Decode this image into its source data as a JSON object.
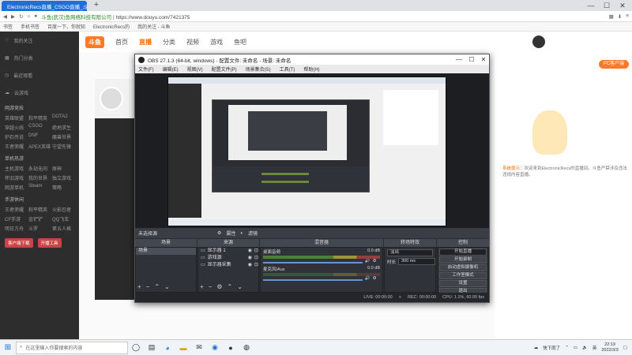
{
  "browser": {
    "tab_title": "ElectronicRecs直播_CSGO直播_斗",
    "new_tab": "+",
    "url_secure": "斗鱼(武汉)鱼网络科技有限公司 |",
    "url": "https://www.douyu.com/7421375",
    "bookmarks": [
      "书签",
      "手机书签",
      "百度一下，你就知",
      "ElectronicRecs的",
      "我的关注 - 斗鱼"
    ],
    "window_controls": [
      "—",
      "☐",
      "✕"
    ]
  },
  "site": {
    "logo": "斗鱼",
    "nav": [
      "首页",
      "直播",
      "分类",
      "视频",
      "游戏",
      "鱼吧"
    ],
    "nav_active": "直播",
    "pc_button": "PC客户端",
    "notice_tag": "系统提示：",
    "notice_text": "欢迎来到ElectronicRecs的直播间。斗鱼严禁涉及违法违规内容直播。",
    "room_number": "12"
  },
  "sidebar": {
    "items": [
      "我的关注",
      "热门分类",
      "最近观看",
      "云游戏"
    ],
    "section_1": "网游竞技",
    "games_1": [
      "英雄联盟",
      "和平精英",
      "DOTA2",
      "穿越火线",
      "CSGO",
      "绝地求生",
      "炉石传说",
      "DNF",
      "魔兽世界",
      "王者荣耀",
      "APEX英雄",
      "守望先锋"
    ],
    "section_2": "单机热游",
    "games_2": [
      "主机游戏",
      "永劫无间",
      "原神",
      "怀旧游戏",
      "我的世界",
      "独立游戏",
      "网游单机",
      "Steam",
      "策略"
    ],
    "section_3": "手游休闲",
    "games_3": [
      "王者荣耀",
      "和平精英",
      "火影忍者",
      "CF手游",
      "金铲铲",
      "QQ飞车",
      "明日方舟",
      "斗罗",
      "第五人格"
    ],
    "btn_1": "客户端下载",
    "btn_2": "开播工具"
  },
  "obs": {
    "title": "OBS 27.1.3 (64-bit, windows) - 配置文件: 未命名 - 场景: 未命名",
    "menu": [
      "文件(F)",
      "编辑(E)",
      "视图(V)",
      "配置文件(P)",
      "场景集合(S)",
      "工具(T)",
      "帮助(H)"
    ],
    "source_status": "未选择源",
    "props_label": "属性",
    "filters_label": "滤镜",
    "dock_titles": [
      "场景",
      "来源",
      "混音器",
      "转场特效",
      "控制"
    ],
    "scenes": [
      "场景"
    ],
    "sources": [
      "显示器 1",
      "游戏源",
      "显示器采集"
    ],
    "mixer": [
      {
        "name": "桌面音频",
        "db": "0.0 dB"
      },
      {
        "name": "麦克风/Aux",
        "db": "0.0 dB"
      }
    ],
    "transition": "淡出",
    "duration_label": "时长",
    "duration": "300 ms",
    "controls": [
      "开始直播",
      "开始录制",
      "启动虚拟摄像机",
      "工作室模式",
      "设置",
      "退出"
    ],
    "status": {
      "live": "LIVE: 00:00:00",
      "rec": "REC: 00:00:00",
      "cpu": "CPU: 1.1%, 60.00 fps"
    }
  },
  "taskbar": {
    "search_placeholder": "在这里输入你要搜索的内容",
    "weather": "快下雨了",
    "time": "22:19",
    "date": "2022/3/3",
    "lang": "英"
  }
}
